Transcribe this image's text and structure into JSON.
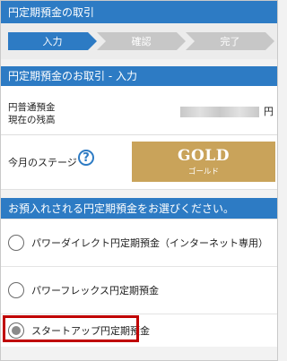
{
  "header": {
    "title": "円定期預金の取引"
  },
  "steps": [
    {
      "label": "入力",
      "state": "active"
    },
    {
      "label": "確認",
      "state": "inactive"
    },
    {
      "label": "完了",
      "state": "inactive"
    }
  ],
  "section1": {
    "title": "円定期預金のお取引 - 入力"
  },
  "balance": {
    "line1": "円普通預金",
    "line2": "現在の残高",
    "unit": "円"
  },
  "stage": {
    "label": "今月のステージ",
    "help": "?",
    "badge_title": "GOLD",
    "badge_sub": "ゴールド"
  },
  "section2": {
    "title": "お預入れされる円定期預金をお選びください。"
  },
  "options": [
    {
      "label": "パワーダイレクト円定期預金（インターネット専用）",
      "selected": false
    },
    {
      "label": "パワーフレックス円定期預金",
      "selected": false
    },
    {
      "label": "スタートアップ円定期預金",
      "selected": true
    }
  ],
  "colors": {
    "primary": "#2d7bc4",
    "gold": "#c9a35a",
    "highlight": "#c00000"
  }
}
